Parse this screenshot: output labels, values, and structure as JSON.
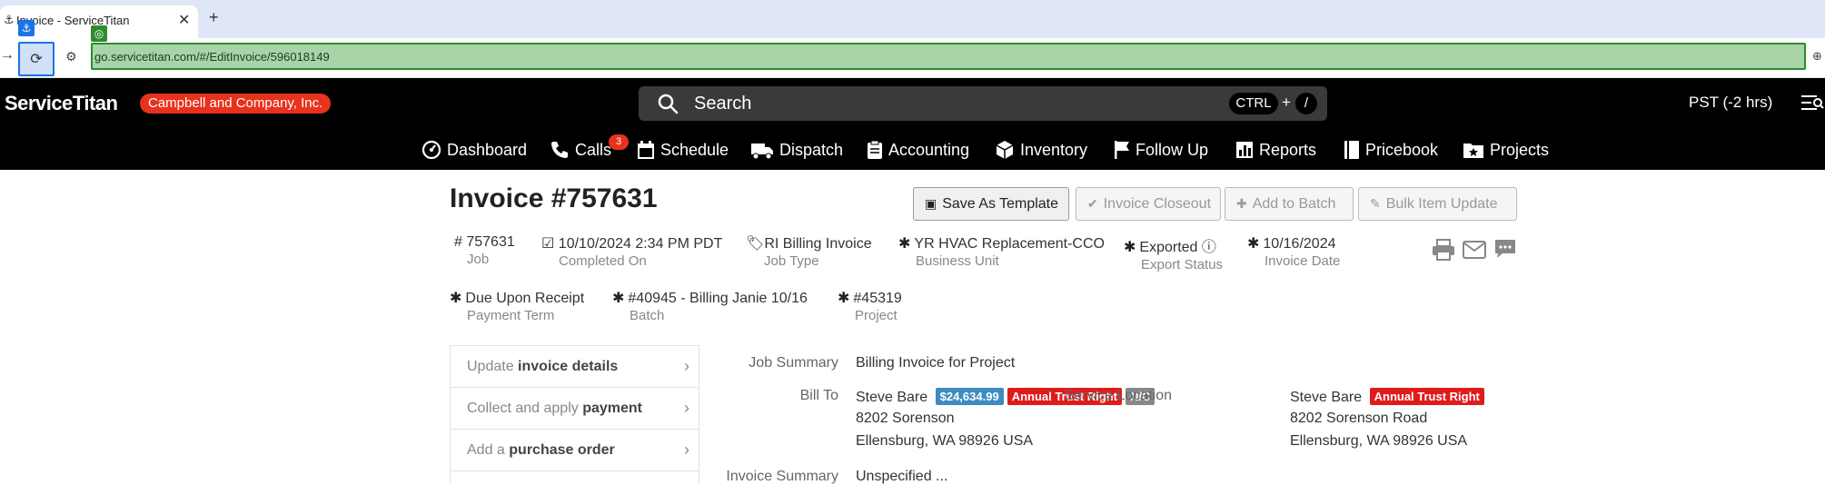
{
  "browser": {
    "tab_title": "Invoice - ServiceTitan",
    "tab_close": "✕",
    "new_tab": "+",
    "url": "go.servicetitan.com/#/EditInvoice/596018149"
  },
  "header": {
    "brand": "ServiceTitan",
    "company": "Campbell and Company, Inc.",
    "search_placeholder": "Search",
    "shortcut_key1": "CTRL",
    "shortcut_plus": "+",
    "shortcut_key2": "/",
    "timezone": "PST (-2 hrs)"
  },
  "nav": {
    "items": [
      {
        "label": "Dashboard",
        "icon": "gauge-icon"
      },
      {
        "label": "Calls",
        "icon": "phone-icon",
        "badge": "3"
      },
      {
        "label": "Schedule",
        "icon": "calendar-icon"
      },
      {
        "label": "Dispatch",
        "icon": "truck-icon"
      },
      {
        "label": "Accounting",
        "icon": "clipboard-icon"
      },
      {
        "label": "Inventory",
        "icon": "cube-icon"
      },
      {
        "label": "Follow Up",
        "icon": "flag-icon"
      },
      {
        "label": "Reports",
        "icon": "bar-chart-icon"
      },
      {
        "label": "Pricebook",
        "icon": "book-icon"
      },
      {
        "label": "Projects",
        "icon": "folder-star-icon"
      }
    ]
  },
  "invoice": {
    "title": "Invoice #757631",
    "actions": {
      "save_template": "Save As Template",
      "closeout": "Invoice Closeout",
      "add_batch": "Add to Batch",
      "bulk_update": "Bulk Item Update"
    },
    "meta": {
      "job": {
        "value": "757631",
        "label": "Job"
      },
      "completed": {
        "value": "10/10/2024 2:34 PM PDT",
        "label": "Completed On"
      },
      "job_type": {
        "value": "RI Billing Invoice",
        "label": "Job Type"
      },
      "business_unit": {
        "value": "YR HVAC Replacement-CCO",
        "label": "Business Unit"
      },
      "export_status": {
        "value": "Exported",
        "label": "Export Status"
      },
      "invoice_date": {
        "value": "10/16/2024",
        "label": "Invoice Date"
      },
      "payment_term": {
        "value": "Due Upon Receipt",
        "label": "Payment Term"
      },
      "batch": {
        "value": "#40945 - Billing Janie 10/16",
        "label": "Batch"
      },
      "project": {
        "value": "#45319",
        "label": "Project"
      }
    },
    "panel": [
      {
        "prefix": "Update",
        "bold": "invoice details"
      },
      {
        "prefix": "Collect and apply",
        "bold": "payment"
      },
      {
        "prefix": "Add a",
        "bold": "purchase order"
      }
    ],
    "summary": {
      "job_summary_label": "Job Summary",
      "job_summary_value": "Billing Invoice for Project",
      "bill_to_label": "Bill To",
      "bill_to_name": "Steve Bare",
      "bill_to_balance": "$24,634.99",
      "bill_to_badge1": "Annual Trust Right",
      "bill_to_badge2": "N/C",
      "bill_to_street": "8202 Sorenson",
      "bill_to_city": "Ellensburg, WA 98926 USA",
      "service_location_label": "Service Location",
      "service_name": "Steve Bare",
      "service_badge": "Annual Trust Right",
      "service_street": "8202 Sorenson Road",
      "service_city": "Ellensburg, WA 98926 USA",
      "invoice_summary_label": "Invoice Summary",
      "invoice_summary_value": "Unspecified ..."
    }
  },
  "colors": {
    "brand_red": "#e8321c",
    "balance_blue": "#3d8bbf",
    "badge_red": "#e01b1b",
    "url_highlight": "#a8d5a8"
  }
}
